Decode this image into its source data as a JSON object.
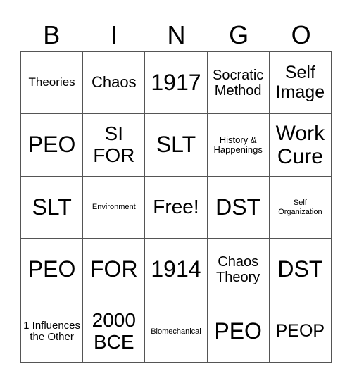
{
  "header": [
    "B",
    "I",
    "N",
    "G",
    "O"
  ],
  "rows": [
    [
      "Theories",
      "Chaos",
      "1917",
      "Socratic Method",
      "Self Image"
    ],
    [
      "PEO",
      "SI FOR",
      "SLT",
      "History & Happenings",
      "Work Cure"
    ],
    [
      "SLT",
      "Environment",
      "Free!",
      "DST",
      "Self Organization"
    ],
    [
      "PEO",
      "FOR",
      "1914",
      "Chaos Theory",
      "DST"
    ],
    [
      "1 Influences the Other",
      "2000 BCE",
      "Biomechanical",
      "PEO",
      "PEOP"
    ]
  ]
}
